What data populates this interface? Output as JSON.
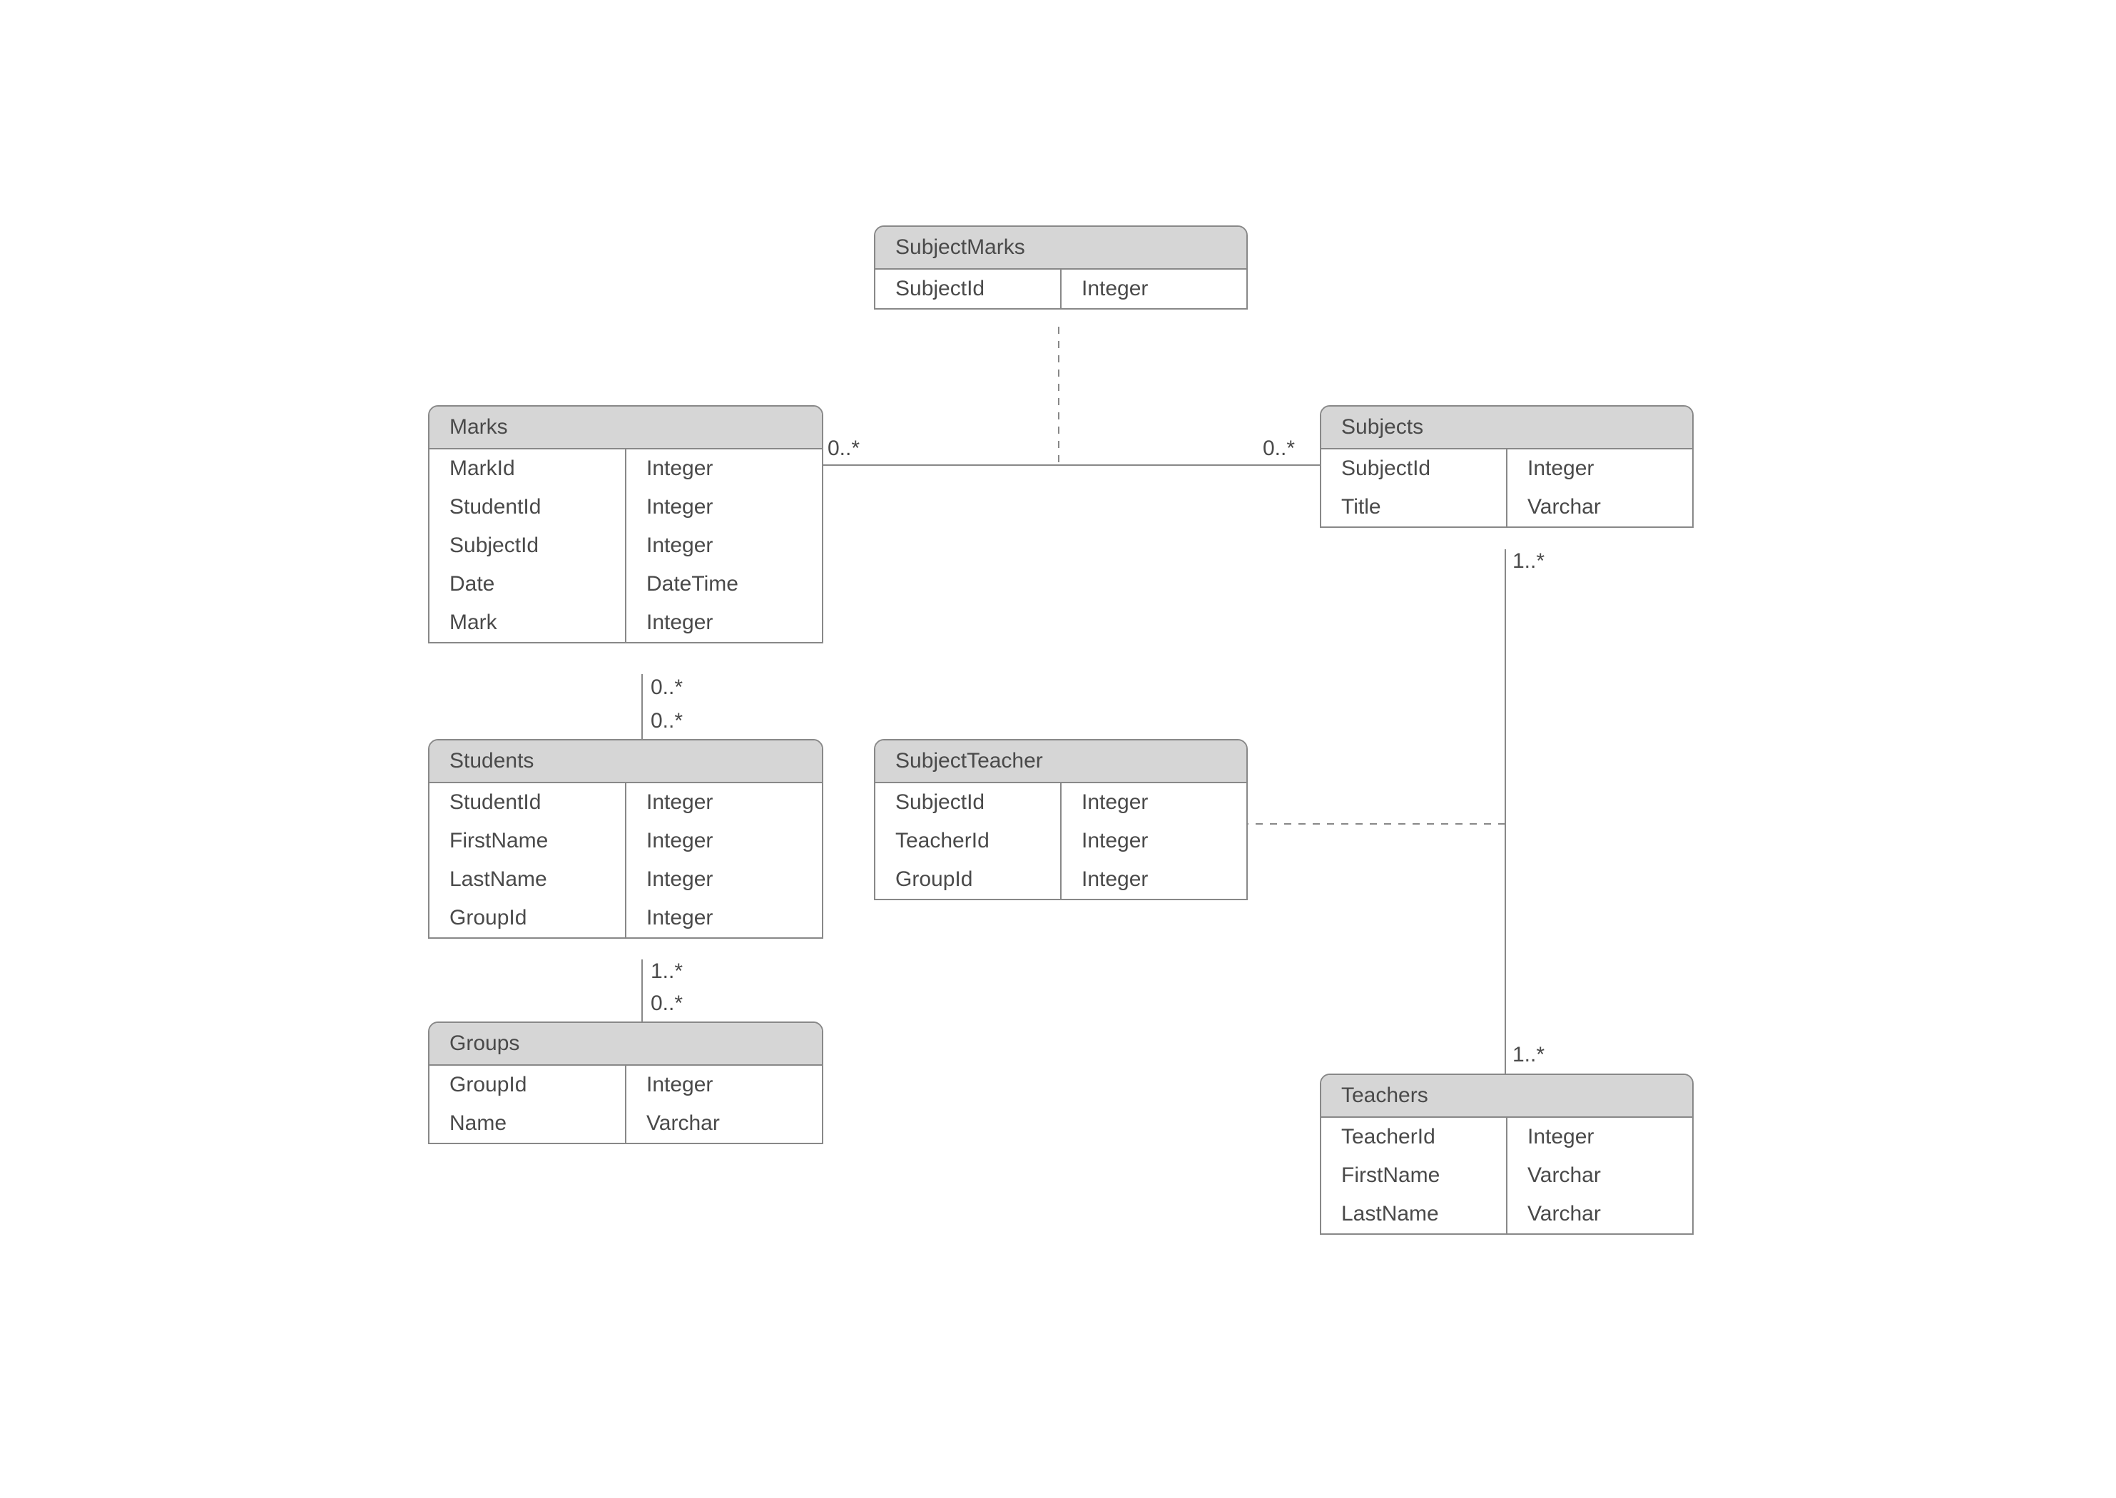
{
  "entities": {
    "subjectMarks": {
      "title": "SubjectMarks",
      "attrs": [
        {
          "name": "SubjectId",
          "type": "Integer"
        }
      ]
    },
    "subjects": {
      "title": "Subjects",
      "attrs": [
        {
          "name": "SubjectId",
          "type": "Integer"
        },
        {
          "name": "Title",
          "type": "Varchar"
        }
      ]
    },
    "marks": {
      "title": "Marks",
      "attrs": [
        {
          "name": "MarkId",
          "type": "Integer"
        },
        {
          "name": "StudentId",
          "type": "Integer"
        },
        {
          "name": "SubjectId",
          "type": "Integer"
        },
        {
          "name": "Date",
          "type": "DateTime"
        },
        {
          "name": "Mark",
          "type": "Integer"
        }
      ]
    },
    "students": {
      "title": "Students",
      "attrs": [
        {
          "name": "StudentId",
          "type": "Integer"
        },
        {
          "name": "FirstName",
          "type": "Integer"
        },
        {
          "name": "LastName",
          "type": "Integer"
        },
        {
          "name": "GroupId",
          "type": "Integer"
        }
      ]
    },
    "subjectTeacher": {
      "title": "SubjectTeacher",
      "attrs": [
        {
          "name": "SubjectId",
          "type": "Integer"
        },
        {
          "name": "TeacherId",
          "type": "Integer"
        },
        {
          "name": "GroupId",
          "type": "Integer"
        }
      ]
    },
    "groups": {
      "title": "Groups",
      "attrs": [
        {
          "name": "GroupId",
          "type": "Integer"
        },
        {
          "name": "Name",
          "type": "Varchar"
        }
      ]
    },
    "teachers": {
      "title": "Teachers",
      "attrs": [
        {
          "name": "TeacherId",
          "type": "Integer"
        },
        {
          "name": "FirstName",
          "type": "Varchar"
        },
        {
          "name": "LastName",
          "type": "Varchar"
        }
      ]
    }
  },
  "multiplicities": {
    "marksToSubjects_left": "0..*",
    "marksToSubjects_right": "0..*",
    "subjects_bottom": "1..*",
    "marks_bottom": "0..*",
    "students_top": "0..*",
    "students_bottom": "1..*",
    "groups_top": "0..*",
    "teachers_top": "1..*"
  }
}
